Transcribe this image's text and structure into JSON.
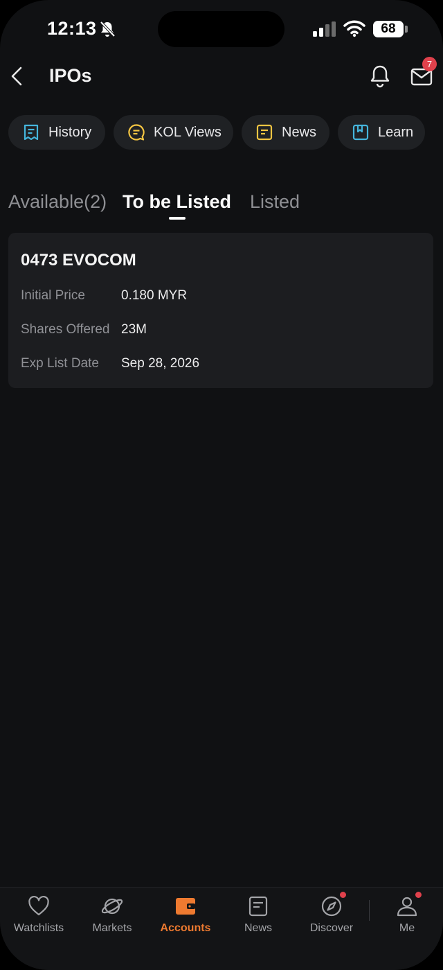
{
  "status_bar": {
    "time": "12:13",
    "battery": "68"
  },
  "header": {
    "title": "IPOs",
    "mail_badge": "7"
  },
  "quick_links": [
    {
      "label": "History",
      "icon": "history-icon",
      "color": "#45b6dd"
    },
    {
      "label": "KOL Views",
      "icon": "chat-bubble-icon",
      "color": "#f4c542"
    },
    {
      "label": "News",
      "icon": "news-icon",
      "color": "#f4c542"
    },
    {
      "label": "Learn",
      "icon": "bookmark-icon",
      "color": "#45b6dd"
    }
  ],
  "tabs": [
    {
      "label": "Available(2)",
      "active": false
    },
    {
      "label": "To be Listed",
      "active": true
    },
    {
      "label": "Listed",
      "active": false
    }
  ],
  "ipo_card": {
    "title": "0473 EVOCOM",
    "rows": [
      {
        "label": "Initial Price",
        "value": "0.180 MYR"
      },
      {
        "label": "Shares Offered",
        "value": "23M"
      },
      {
        "label": "Exp List Date",
        "value": "Sep 28, 2026"
      }
    ]
  },
  "bottom_nav": [
    {
      "label": "Watchlists",
      "icon": "heart-icon",
      "active": false
    },
    {
      "label": "Markets",
      "icon": "planet-icon",
      "active": false
    },
    {
      "label": "Accounts",
      "icon": "wallet-icon",
      "active": true
    },
    {
      "label": "News",
      "icon": "news-icon",
      "active": false
    },
    {
      "label": "Discover",
      "icon": "compass-icon",
      "active": false
    },
    {
      "label": "Me",
      "icon": "person-icon",
      "active": false
    }
  ],
  "colors": {
    "accent": "#ee7a30",
    "badge": "#e0414c",
    "background": "#101113",
    "card": "#1c1d20"
  }
}
